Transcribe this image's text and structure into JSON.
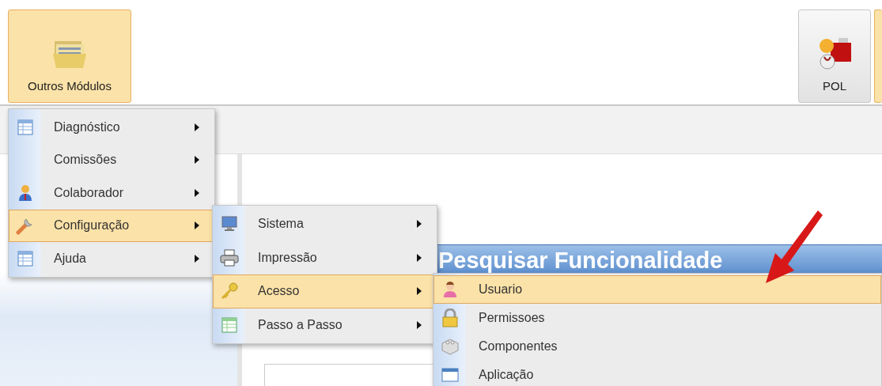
{
  "toolbar": {
    "buttons": [
      {
        "label": "Outros Módulos",
        "selected": true
      },
      {
        "label": "POL",
        "selected": false
      }
    ]
  },
  "dialog": {
    "title": "Pesquisar Funcionalidade"
  },
  "menus": [
    {
      "items": [
        {
          "label": "Diagnóstico",
          "submenu": true,
          "selected": false
        },
        {
          "label": "Comissões",
          "submenu": true,
          "selected": false
        },
        {
          "label": "Colaborador",
          "submenu": true,
          "selected": false
        },
        {
          "label": "Configuração",
          "submenu": true,
          "selected": true
        },
        {
          "label": "Ajuda",
          "submenu": true,
          "selected": false
        }
      ]
    },
    {
      "items": [
        {
          "label": "Sistema",
          "submenu": true,
          "selected": false
        },
        {
          "label": "Impressão",
          "submenu": true,
          "selected": false
        },
        {
          "label": "Acesso",
          "submenu": true,
          "selected": true
        },
        {
          "label": "Passo a Passo",
          "submenu": true,
          "selected": false
        }
      ]
    },
    {
      "items": [
        {
          "label": "Usuario",
          "submenu": false,
          "selected": true
        },
        {
          "label": "Permissoes",
          "submenu": false,
          "selected": false
        },
        {
          "label": "Componentes",
          "submenu": false,
          "selected": false
        },
        {
          "label": "Aplicação",
          "submenu": false,
          "selected": false
        }
      ]
    }
  ]
}
